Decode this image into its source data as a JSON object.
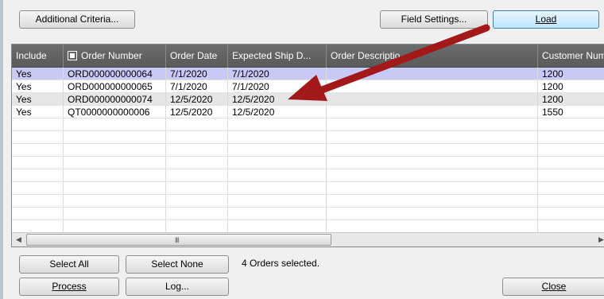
{
  "toolbar": {
    "additional_criteria_label": "Additional Criteria...",
    "field_settings_label": "Field Settings...",
    "load_label": "Load"
  },
  "grid": {
    "columns": [
      "Include",
      "Order Number",
      "Order Date",
      "Expected Ship D...",
      "Order Descriptio",
      "Customer Num"
    ],
    "rows": [
      {
        "include": "Yes",
        "order_number": "ORD000000000064",
        "order_date": "7/1/2020",
        "ship_date": "7/1/2020",
        "description": "",
        "customer": "1200"
      },
      {
        "include": "Yes",
        "order_number": "ORD000000000065",
        "order_date": "7/1/2020",
        "ship_date": "7/1/2020",
        "description": "",
        "customer": "1200"
      },
      {
        "include": "Yes",
        "order_number": "ORD000000000074",
        "order_date": "12/5/2020",
        "ship_date": "12/5/2020",
        "description": "",
        "customer": "1200"
      },
      {
        "include": "Yes",
        "order_number": "QT0000000000006",
        "order_date": "12/5/2020",
        "ship_date": "12/5/2020",
        "description": "",
        "customer": "1550"
      }
    ],
    "scroll_grip": "III"
  },
  "footer": {
    "select_all_label": "Select All",
    "select_none_label": "Select None",
    "status_text": "4 Orders selected.",
    "process_label": "Process",
    "log_label": "Log...",
    "close_label": "Close"
  },
  "colors": {
    "header_bg": "#5a5a5a",
    "selected_row": "#c9c9f5",
    "annotation_arrow": "#a31818"
  },
  "icons": {
    "order_number_header": "sort-key-icon",
    "scroll_left": "chevron-left-icon",
    "scroll_right": "chevron-right-icon",
    "annotation": "red-arrow-annotation"
  }
}
